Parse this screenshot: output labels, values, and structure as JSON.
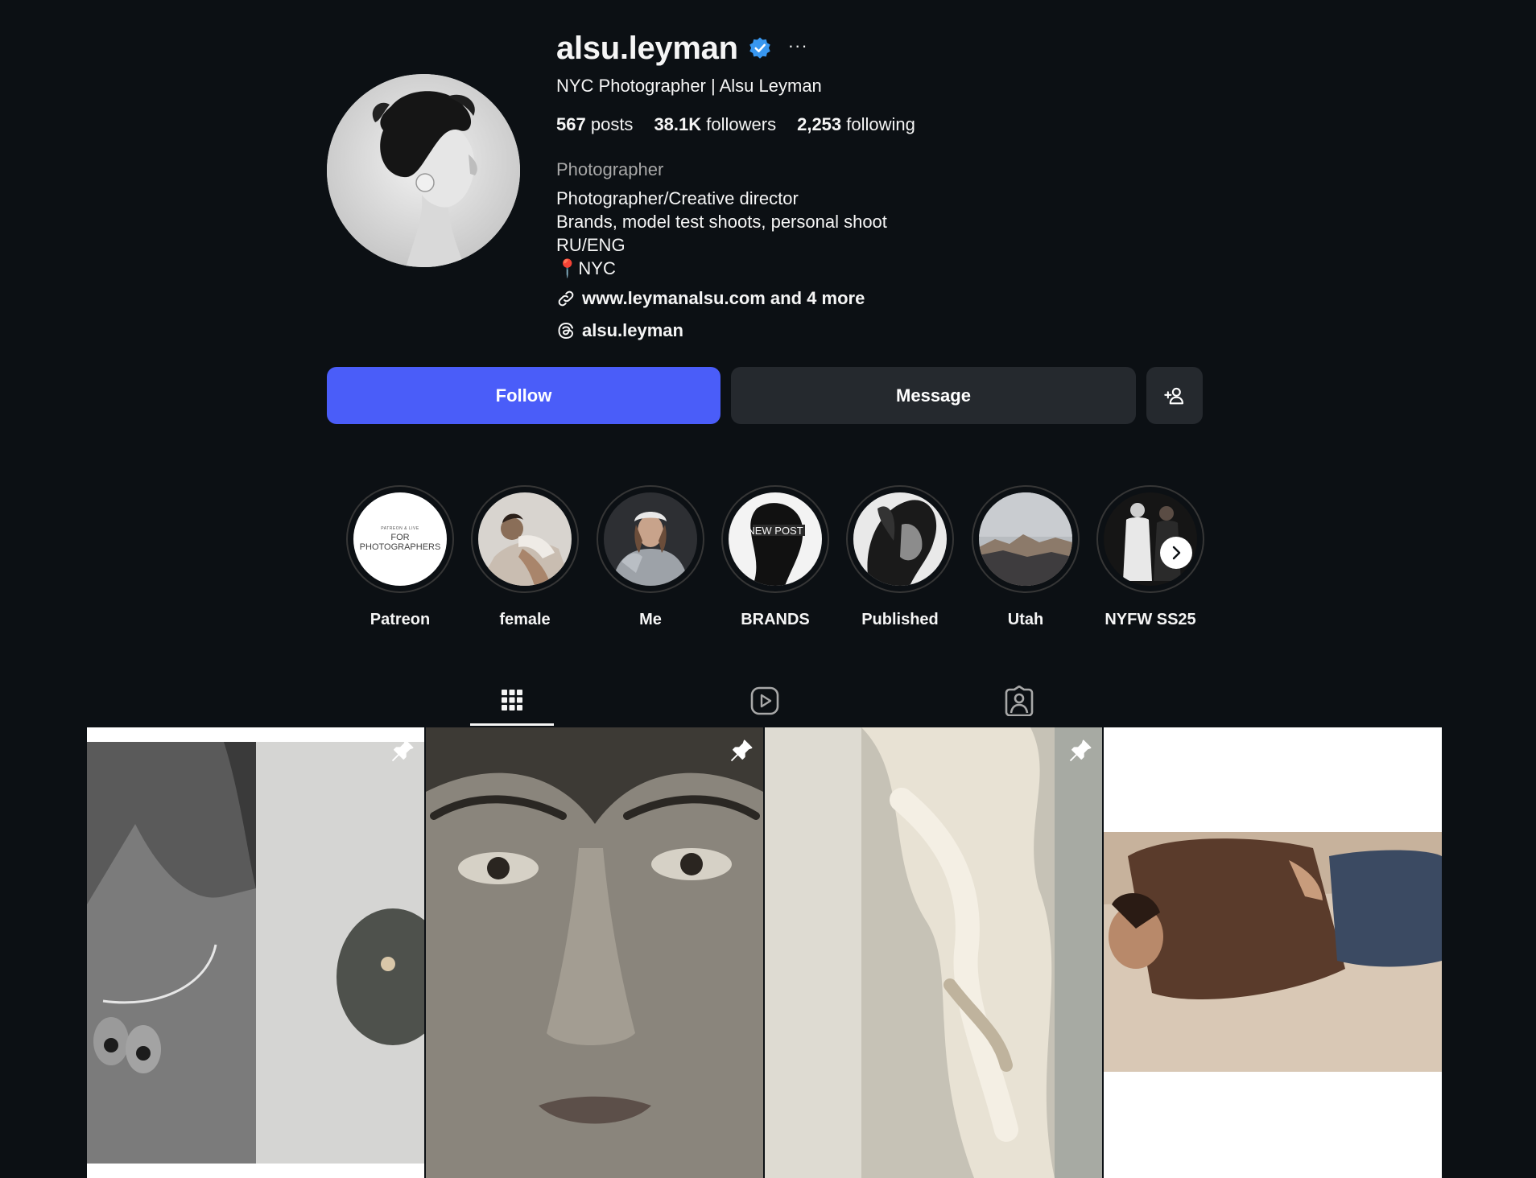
{
  "profile": {
    "username": "alsu.leyman",
    "verified": true,
    "more_label": "···",
    "full_name": "NYC Photographer | Alsu Leyman",
    "stats": {
      "posts_count": "567",
      "posts_label": "posts",
      "followers_count": "38.1K",
      "followers_label": "followers",
      "following_count": "2,253",
      "following_label": "following"
    },
    "category": "Photographer",
    "bio": [
      "Photographer/Creative director",
      "Brands, model test shoots, personal shoot",
      "RU/ENG",
      "📍NYC"
    ],
    "link_text": "www.leymanalsu.com and 4 more",
    "threads_handle": "alsu.leyman"
  },
  "actions": {
    "follow_label": "Follow",
    "message_label": "Message"
  },
  "highlights": [
    {
      "label": "Patreon",
      "cover_text_small": "PATREON & LIVE",
      "cover_text": "FOR PHOTOGRAPHERS"
    },
    {
      "label": "female"
    },
    {
      "label": "Me"
    },
    {
      "label": "BRANDS",
      "cover_text": "NEW POST"
    },
    {
      "label": "Published"
    },
    {
      "label": "Utah"
    },
    {
      "label": "NYFW SS25"
    }
  ],
  "tabs": [
    {
      "name": "posts",
      "icon": "grid-icon",
      "active": true
    },
    {
      "name": "reels",
      "icon": "reels-icon",
      "active": false
    },
    {
      "name": "tagged",
      "icon": "tagged-icon",
      "active": false
    }
  ],
  "posts": [
    {
      "pinned": true
    },
    {
      "pinned": true
    },
    {
      "pinned": true
    },
    {
      "pinned": false
    }
  ],
  "colors": {
    "background": "#0c1014",
    "follow_button": "#4a5df9",
    "secondary_button": "#25292e",
    "verified_badge": "#3897f0",
    "muted_text": "#a8a8a8"
  }
}
